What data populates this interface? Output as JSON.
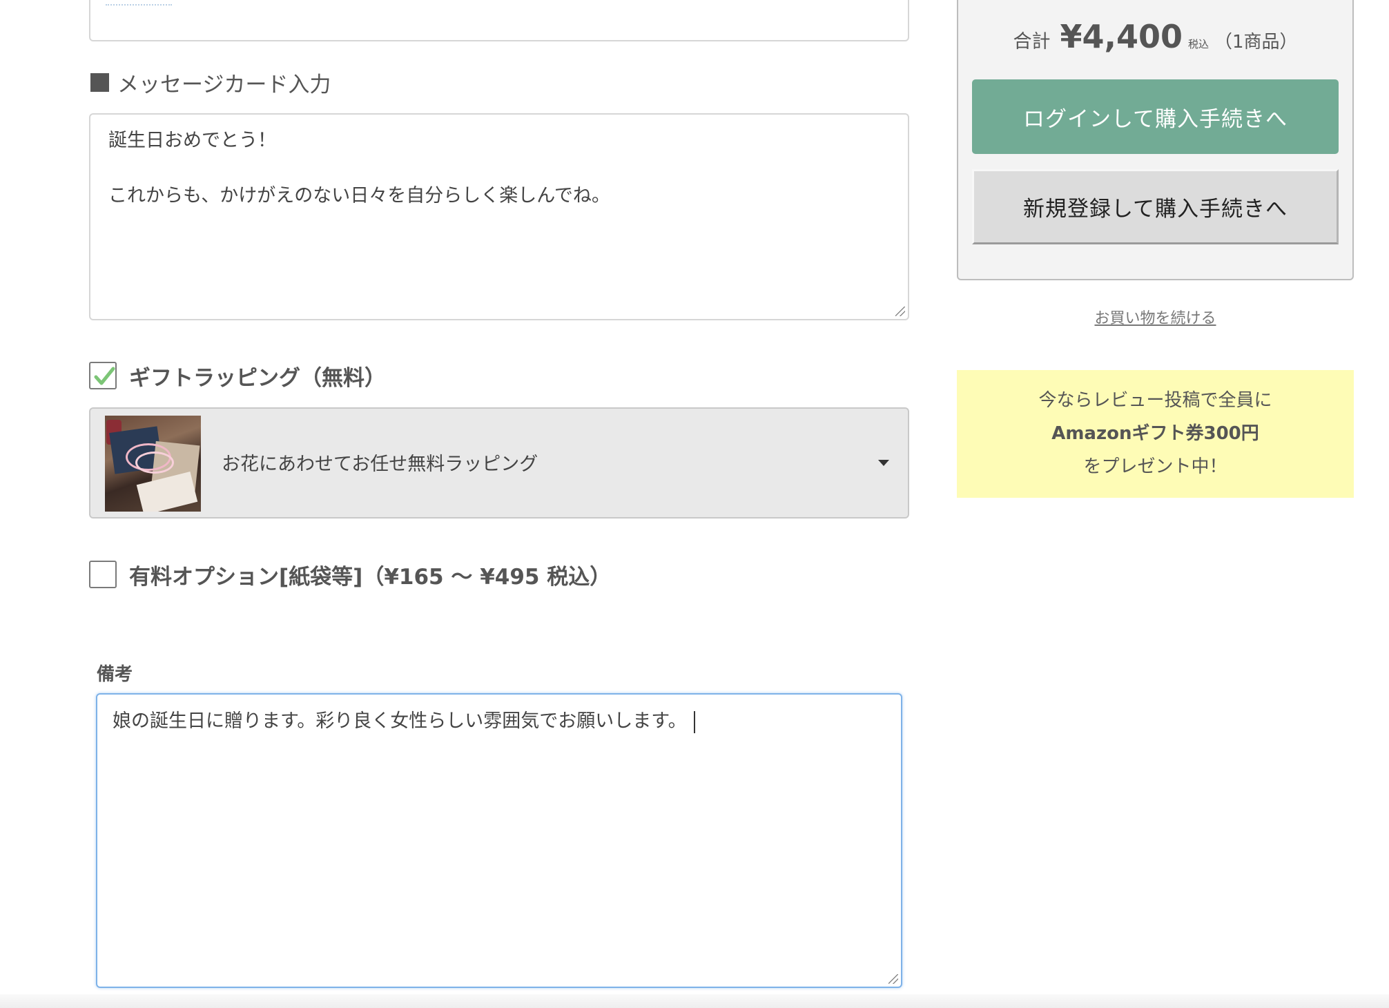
{
  "message_card": {
    "title": "メッセージカード入力",
    "lines": [
      "誕生日おめでとう！",
      "",
      "これからも、かけがえのない日々を自分らしく楽しんでね。"
    ]
  },
  "gift_wrapping": {
    "label": "ギフトラッピング（無料）",
    "checked": true,
    "selected_option": "お花にあわせてお任せ無料ラッピング"
  },
  "paid_option": {
    "label": "有料オプション[紙袋等]（¥165 〜 ¥495 税込）",
    "checked": false
  },
  "remarks": {
    "label": "備考",
    "value": "娘の誕生日に贈ります。彩り良く女性らしい雰囲気でお願いします。"
  },
  "summary": {
    "total_label": "合計",
    "total_amount": "¥4,400",
    "tax_label": "税込",
    "item_count": "（1商品）",
    "login_button": "ログインして購入手続きへ",
    "register_button": "新規登録して購入手続きへ",
    "continue_link": "お買い物を続ける"
  },
  "promo": {
    "line1": "今ならレビュー投稿で全員に",
    "line2": "Amazonギフト券300円",
    "line3": "をプレゼント中！"
  },
  "colors": {
    "accent_green": "#72ab95",
    "promo_yellow": "#fefcb6",
    "focus_blue": "#7eb2e8",
    "check_green": "#7cc576"
  }
}
